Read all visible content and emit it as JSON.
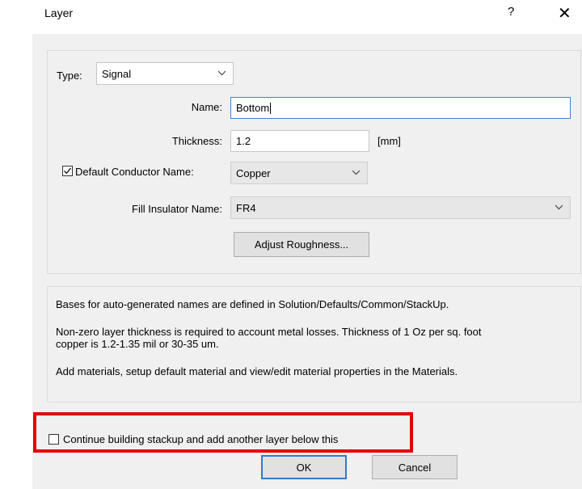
{
  "window": {
    "title": "Layer",
    "help_label": "?",
    "close_label": "✕"
  },
  "form": {
    "type_label": "Type:",
    "type_value": "Signal",
    "name_label": "Name:",
    "name_value": "Bottom",
    "thickness_label": "Thickness:",
    "thickness_value": "1.2",
    "thickness_unit": "[mm]",
    "default_conductor_label": "Default Conductor Name:",
    "default_conductor_checked": true,
    "conductor_value": "Copper",
    "fill_insulator_label": "Fill Insulator Name:",
    "fill_insulator_value": "FR4",
    "adjust_roughness_label": "Adjust Roughness..."
  },
  "info": {
    "line1": "Bases for auto-generated names are defined in Solution/Defaults/Common/StackUp.",
    "line2a": "Non-zero layer thickness is required to account metal losses. Thickness of 1 Oz per sq. foot",
    "line2b": "copper is 1.2-1.35 mil or 30-35 um.",
    "line3": "Add materials, setup default material and view/edit material properties in the Materials."
  },
  "footer": {
    "continue_label": "Continue building stackup and add another layer below this",
    "continue_checked": false,
    "ok_label": "OK",
    "cancel_label": "Cancel"
  },
  "icons": {
    "chevron": "chevron-down-icon",
    "check": "check-icon"
  },
  "colors": {
    "highlight": "#e30000",
    "focus": "#3f7fd6"
  }
}
